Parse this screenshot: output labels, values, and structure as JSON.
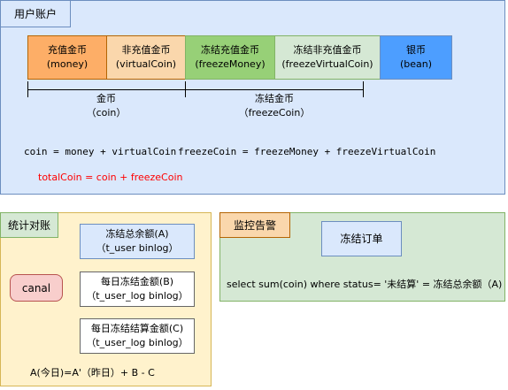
{
  "colors": {
    "account_panel_bg": "#dae8fc",
    "account_panel_border": "#6c8ebf",
    "money_bg": "#fdae67",
    "virtual_bg": "#fad7ac",
    "freeze_money_bg": "#97d077",
    "freeze_virtual_bg": "#d5e8d4",
    "bean_bg": "#4d9eff",
    "stats_panel_bg": "#fff2cc",
    "stats_panel_border": "#d6b656",
    "canal_bg": "#f8cecc",
    "canal_border": "#b85450",
    "monitor_panel_bg": "#d5e8d4",
    "monitor_panel_border": "#82b366",
    "red_text": "#ff0000"
  },
  "account": {
    "title": "用户账户",
    "cells": [
      {
        "cn": "充值金币",
        "en": "(money)"
      },
      {
        "cn": "非充值金币",
        "en": "(virtualCoin)"
      },
      {
        "cn": "冻结充值金币",
        "en": "(freezeMoney)"
      },
      {
        "cn": "冻结非充值金币",
        "en": "(freezeVirtualCoin)"
      },
      {
        "cn": "银币",
        "en": "(bean)"
      }
    ],
    "groups": [
      {
        "cn": "金币",
        "en": "（coin）"
      },
      {
        "cn": "冻结金币",
        "en": "（freezeCoin）"
      }
    ],
    "formula_coin": "coin = money + virtualCoin",
    "formula_freeze": "freezeCoin = freezeMoney + freezeVirtualCoin",
    "formula_total": "totalCoin = coin + freezeCoin"
  },
  "stats": {
    "title": "统计对账",
    "canal": "canal",
    "boxes": [
      {
        "line1": "冻结总余额(A)",
        "line2": "（t_user binlog）"
      },
      {
        "line1": "每日冻结金额(B)",
        "line2": "（t_user_log binlog）"
      },
      {
        "line1": "每日冻结结算金额(C)",
        "line2": "（t_user_log binlog）"
      }
    ],
    "formula": "A(今日)=A'（昨日）+ B - C"
  },
  "monitor": {
    "title": "监控告警",
    "box": "冻结订单",
    "sql": "select sum(coin) where status= '未结算' = 冻结总余额（A)"
  }
}
